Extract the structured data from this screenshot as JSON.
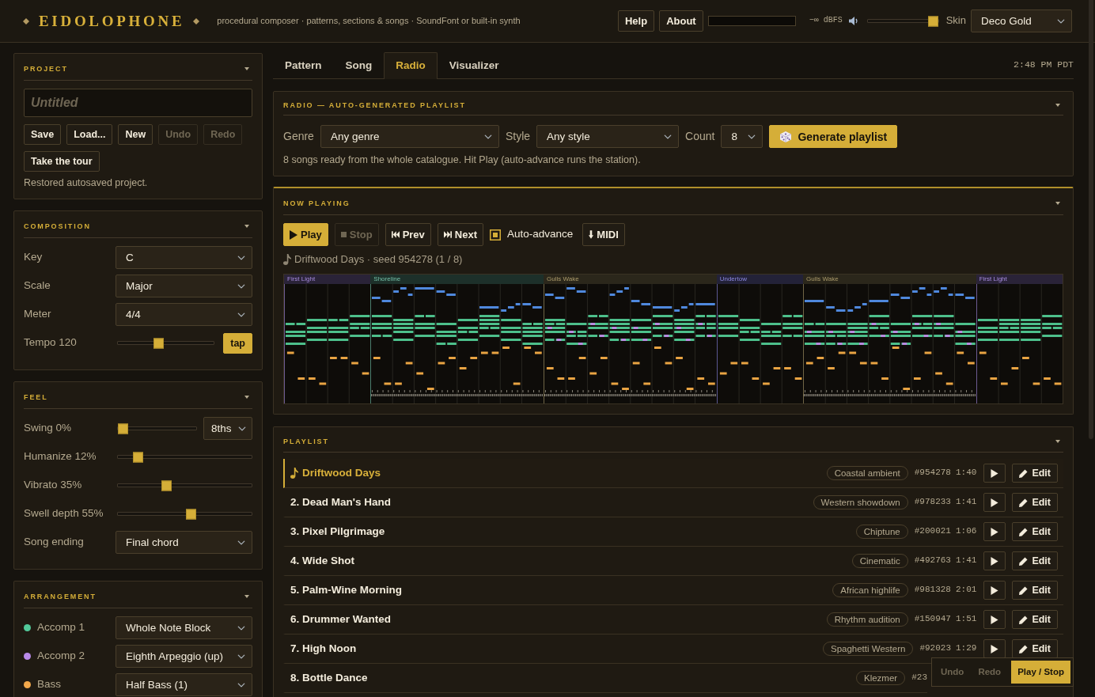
{
  "header": {
    "logo": "EIDOLOPHONE",
    "tagline": "procedural composer · patterns, sections & songs · SoundFont or built-in synth",
    "buttons": [
      "Help",
      "About"
    ],
    "readout": "−∞ dBFS",
    "volume": {
      "level": 1
    },
    "skin": {
      "label": "Skin",
      "value": "Deco Gold"
    }
  },
  "sidebar": [
    {
      "kind": "project",
      "title": "PROJECT",
      "expanded": true,
      "name_field": {
        "placeholder": "Untitled"
      },
      "buttons": [
        {
          "label": "Save",
          "disabled": false
        },
        {
          "label": "Load...",
          "disabled": false
        },
        {
          "label": "New",
          "disabled": false
        },
        {
          "label": "Undo",
          "disabled": true
        },
        {
          "label": "Redo",
          "disabled": true
        }
      ],
      "tour_button": "Take the tour",
      "status": "Restored autosaved project."
    },
    {
      "kind": "form",
      "title": "COMPOSITION",
      "expanded": true,
      "rows": [
        {
          "kind": "select",
          "label": "Key",
          "value": "C"
        },
        {
          "kind": "select",
          "label": "Scale",
          "value": "Major"
        },
        {
          "kind": "select",
          "label": "Meter",
          "value": "4/4"
        },
        {
          "kind": "slider",
          "label": "Tempo 120",
          "level": 0.42,
          "button": "tap"
        }
      ]
    },
    {
      "kind": "form",
      "title": "FEEL",
      "expanded": true,
      "rows": [
        {
          "kind": "slider",
          "label": "Swing 0%",
          "level": 0,
          "select": "8ths"
        },
        {
          "kind": "slider",
          "label": "Humanize 12%",
          "level": 0.12
        },
        {
          "kind": "slider",
          "label": "Vibrato 35%",
          "level": 0.35
        },
        {
          "kind": "slider",
          "label": "Swell depth 55%",
          "level": 0.55
        },
        {
          "kind": "select",
          "label": "Song ending",
          "value": "Final chord"
        }
      ]
    },
    {
      "kind": "form",
      "title": "ARRANGEMENT",
      "expanded": true,
      "rows": [
        {
          "kind": "voice",
          "label": "Accomp 1",
          "color": "#52c99a",
          "value": "Whole Note Block"
        },
        {
          "kind": "voice",
          "label": "Accomp 2",
          "color": "#b98ae8",
          "value": "Eighth Arpeggio (up)"
        },
        {
          "kind": "voice",
          "label": "Bass",
          "color": "#f2a84b",
          "value": "Half Bass (1)"
        }
      ]
    }
  ],
  "tabs": [
    {
      "label": "Pattern",
      "selected": false
    },
    {
      "label": "Song",
      "selected": false
    },
    {
      "label": "Radio",
      "selected": true
    },
    {
      "label": "Visualizer",
      "selected": false
    }
  ],
  "clock": "2:48 PM PDT",
  "radio": {
    "title": "RADIO — AUTO-GENERATED PLAYLIST",
    "expanded": true,
    "fields": [
      {
        "label": "Genre",
        "value": "Any genre"
      },
      {
        "label": "Style",
        "value": "Any style"
      },
      {
        "label": "Count",
        "value": "8"
      }
    ],
    "generate_button": "Generate playlist",
    "note": "8 songs ready from the whole catalogue. Hit Play (auto-advance runs the station)."
  },
  "now_playing": {
    "title": "NOW PLAYING",
    "expanded": true,
    "controls": [
      {
        "kind": "play",
        "label": "Play",
        "disabled": false
      },
      {
        "kind": "stop",
        "label": "Stop",
        "disabled": true
      },
      {
        "kind": "prev",
        "label": "Prev",
        "disabled": false
      },
      {
        "kind": "next",
        "label": "Next",
        "disabled": false
      },
      {
        "kind": "checkbox",
        "label": "Auto-advance",
        "checked": true
      },
      {
        "kind": "download",
        "label": "MIDI",
        "disabled": false
      }
    ],
    "track_info": "Driftwood Days · seed 954278 (1 / 8)",
    "sections": [
      {
        "label": "First Light",
        "kind": "short",
        "color": "#2a2338"
      },
      {
        "label": "Shoreline",
        "kind": "long",
        "color": "#1d302a"
      },
      {
        "label": "Gulls Wake",
        "kind": "long",
        "color": "#2b271b"
      },
      {
        "label": "Undertow",
        "kind": "short",
        "color": "#232238"
      },
      {
        "label": "Gulls Wake",
        "kind": "long",
        "color": "#2b271b"
      },
      {
        "label": "First Light",
        "kind": "short",
        "color": "#2a2338"
      }
    ]
  },
  "playlist": {
    "title": "PLAYLIST",
    "expanded": true,
    "rows": [
      {
        "title": "Driftwood Days",
        "selected": true,
        "tag": "Coastal ambient",
        "seed": "#954278",
        "duration": "1:40",
        "edit": "Edit"
      },
      {
        "title": "2. Dead Man's Hand",
        "selected": false,
        "tag": "Western showdown",
        "seed": "#978233",
        "duration": "1:41",
        "edit": "Edit"
      },
      {
        "title": "3. Pixel Pilgrimage",
        "selected": false,
        "tag": "Chiptune",
        "seed": "#200021",
        "duration": "1:06",
        "edit": "Edit"
      },
      {
        "title": "4. Wide Shot",
        "selected": false,
        "tag": "Cinematic",
        "seed": "#492763",
        "duration": "1:41",
        "edit": "Edit"
      },
      {
        "title": "5. Palm-Wine Morning",
        "selected": false,
        "tag": "African highlife",
        "seed": "#981328",
        "duration": "2:01",
        "edit": "Edit"
      },
      {
        "title": "6. Drummer Wanted",
        "selected": false,
        "tag": "Rhythm audition",
        "seed": "#150947",
        "duration": "1:51",
        "edit": "Edit"
      },
      {
        "title": "7. High Noon",
        "selected": false,
        "tag": "Spaghetti Western",
        "seed": "#92023",
        "duration": "1:29",
        "edit": "Edit"
      },
      {
        "title": "8. Bottle Dance",
        "selected": false,
        "tag": "Klezmer",
        "seed": "#23"
      }
    ]
  },
  "quickbar": [
    {
      "kind": "plain",
      "label": "Undo",
      "disabled": true
    },
    {
      "kind": "plain",
      "label": "Redo",
      "disabled": true
    },
    {
      "kind": "primary",
      "label": "Play / Stop",
      "disabled": false
    }
  ]
}
